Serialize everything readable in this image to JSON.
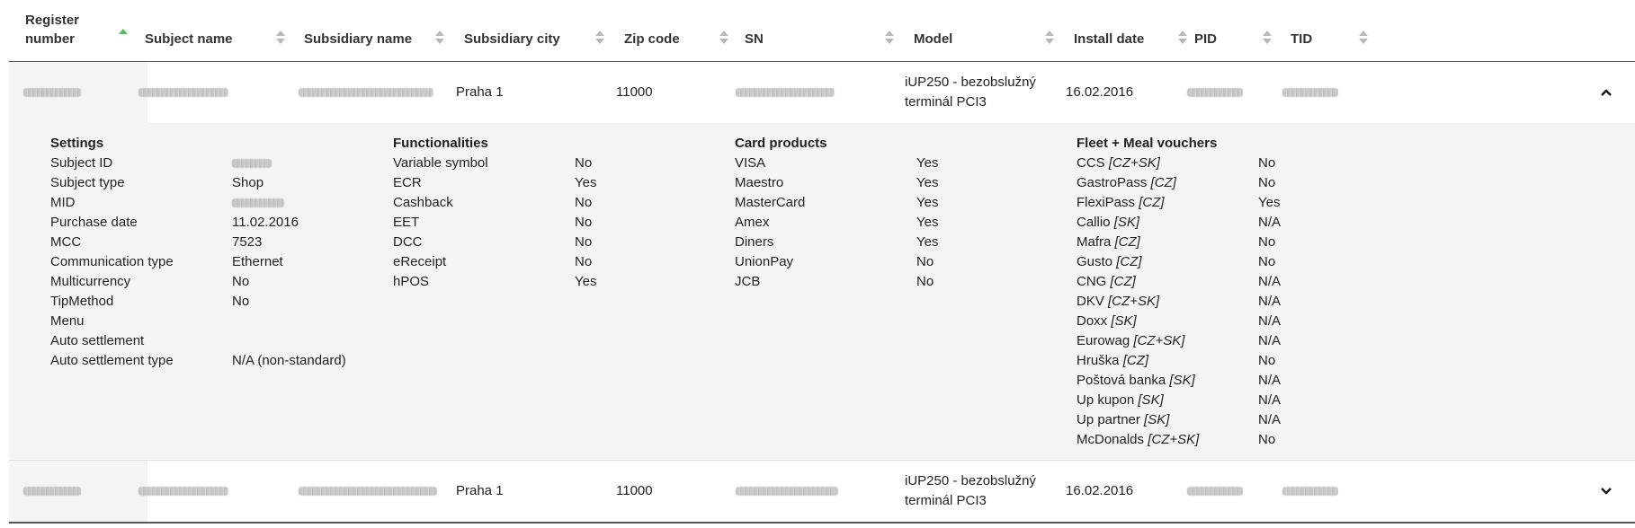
{
  "columns": [
    {
      "label": "Register number",
      "sort": "asc"
    },
    {
      "label": "Subject name",
      "sort": "none"
    },
    {
      "label": "Subsidiary name",
      "sort": "none"
    },
    {
      "label": "Subsidiary city",
      "sort": "none"
    },
    {
      "label": "Zip code",
      "sort": "none"
    },
    {
      "label": "SN",
      "sort": "none"
    },
    {
      "label": "Model",
      "sort": "none"
    },
    {
      "label": "Install date",
      "sort": "none"
    },
    {
      "label": "PID",
      "sort": "none"
    },
    {
      "label": "TID",
      "sort": "none"
    }
  ],
  "rows": [
    {
      "city": "Praha 1",
      "zip": "11000",
      "model_line1": "iUP250 - bezobslužný",
      "model_line2": "terminál PCI3",
      "install_date": "16.02.2016",
      "expanded": true,
      "toggle_icon": "chevron-up-icon"
    },
    {
      "city": "Praha 1",
      "zip": "11000",
      "model_line1": "iUP250 - bezobslužný",
      "model_line2": "terminál PCI3",
      "install_date": "16.02.2016",
      "expanded": false,
      "toggle_icon": "chevron-down-icon"
    }
  ],
  "details": {
    "settings": {
      "title": "Settings",
      "items": [
        {
          "key": "Subject ID",
          "value": ""
        },
        {
          "key": "Subject type",
          "value": "Shop"
        },
        {
          "key": "MID",
          "value": ""
        },
        {
          "key": "Purchase date",
          "value": "11.02.2016"
        },
        {
          "key": "MCC",
          "value": "7523"
        },
        {
          "key": "Communication type",
          "value": "Ethernet"
        },
        {
          "key": "Multicurrency",
          "value": "No"
        },
        {
          "key": "TipMethod",
          "value": "No"
        },
        {
          "key": "Menu",
          "value": ""
        },
        {
          "key": "Auto settlement",
          "value": ""
        },
        {
          "key": "Auto settlement type",
          "value": "N/A (non-standard)"
        }
      ]
    },
    "functionalities": {
      "title": "Functionalities",
      "items": [
        {
          "key": "Variable symbol",
          "value": "No"
        },
        {
          "key": "ECR",
          "value": "Yes"
        },
        {
          "key": "Cashback",
          "value": "No"
        },
        {
          "key": "EET",
          "value": "No"
        },
        {
          "key": "DCC",
          "value": "No"
        },
        {
          "key": "eReceipt",
          "value": "No"
        },
        {
          "key": "hPOS",
          "value": "Yes"
        }
      ]
    },
    "card_products": {
      "title": "Card products",
      "items": [
        {
          "key": "VISA",
          "value": "Yes"
        },
        {
          "key": "Maestro",
          "value": "Yes"
        },
        {
          "key": "MasterCard",
          "value": "Yes"
        },
        {
          "key": "Amex",
          "value": "Yes"
        },
        {
          "key": "Diners",
          "value": "Yes"
        },
        {
          "key": "UnionPay",
          "value": "No"
        },
        {
          "key": "JCB",
          "value": "No"
        }
      ]
    },
    "fleet": {
      "title": "Fleet + Meal vouchers",
      "items": [
        {
          "key": "CCS",
          "region": "[CZ+SK]",
          "value": "No"
        },
        {
          "key": "GastroPass",
          "region": "[CZ]",
          "value": "No"
        },
        {
          "key": "FlexiPass",
          "region": "[CZ]",
          "value": "Yes"
        },
        {
          "key": "Callio",
          "region": "[SK]",
          "value": "N/A"
        },
        {
          "key": "Mafra",
          "region": "[CZ]",
          "value": "No"
        },
        {
          "key": "Gusto",
          "region": "[CZ]",
          "value": "No"
        },
        {
          "key": "CNG",
          "region": "[CZ]",
          "value": "N/A"
        },
        {
          "key": "DKV",
          "region": "[CZ+SK]",
          "value": "N/A"
        },
        {
          "key": "Doxx",
          "region": "[SK]",
          "value": "N/A"
        },
        {
          "key": "Eurowag",
          "region": "[CZ+SK]",
          "value": "N/A"
        },
        {
          "key": "Hruška",
          "region": "[CZ]",
          "value": "No"
        },
        {
          "key": "Poštová banka",
          "region": "[SK]",
          "value": "N/A"
        },
        {
          "key": "Up kupon",
          "region": "[SK]",
          "value": "N/A"
        },
        {
          "key": "Up partner",
          "region": "[SK]",
          "value": "N/A"
        },
        {
          "key": "McDonalds",
          "region": "[CZ+SK]",
          "value": "No"
        }
      ]
    }
  },
  "colors": {
    "sort_active": "#5cb85c",
    "sort_inactive": "#b8b8b8",
    "panel_bg": "#f4f4f4",
    "border": "#555555"
  }
}
